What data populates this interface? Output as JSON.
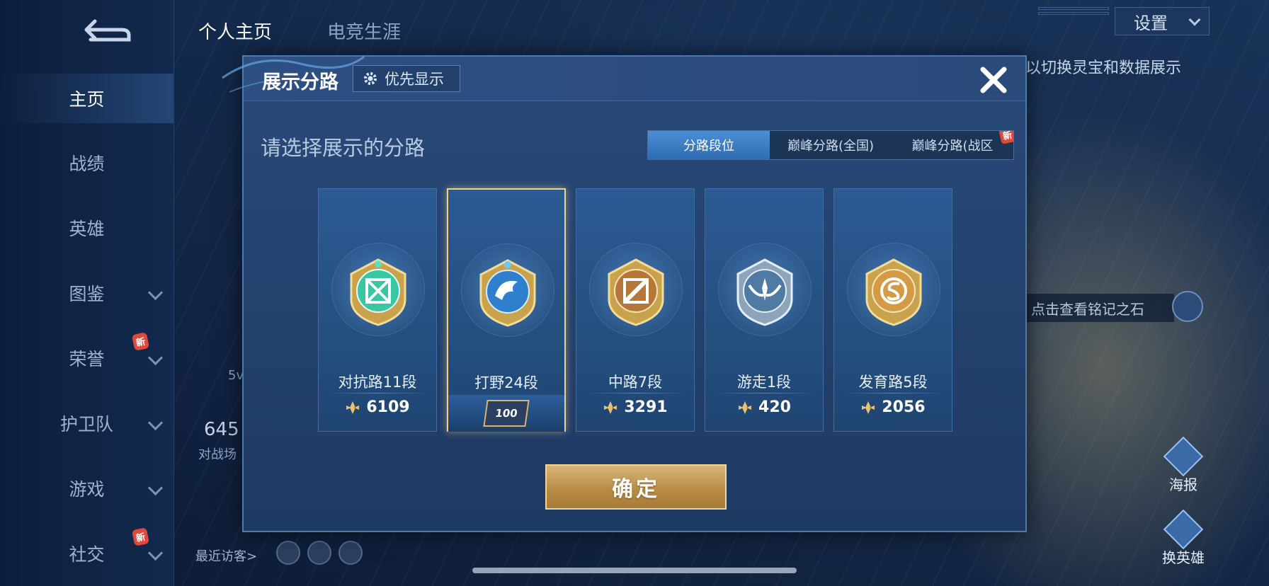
{
  "nav": {
    "items": [
      {
        "label": "主页"
      },
      {
        "label": "战绩"
      },
      {
        "label": "英雄"
      },
      {
        "label": "图鉴"
      },
      {
        "label": "荣誉",
        "badge": "新"
      },
      {
        "label": "护卫队"
      },
      {
        "label": "游戏"
      },
      {
        "label": "社交",
        "badge": "新"
      }
    ]
  },
  "top_tabs": [
    "个人主页",
    "电竞生涯"
  ],
  "settings": {
    "label": "设置"
  },
  "right_hint": "以切换灵宝和数据展示",
  "inscription_hint": "点击查看铭记之石",
  "side_buttons": [
    "海报",
    "换英雄"
  ],
  "visitors_label": "最近访客>",
  "left_obscured": {
    "num": "645",
    "sub": "对战场",
    "small": "5v"
  },
  "dialog": {
    "title": "展示分路",
    "priority_label": "优先显示",
    "subtitle": "请选择展示的分路",
    "segments": [
      {
        "label": "分路段位",
        "active": true
      },
      {
        "label": "巅峰分路(全国)",
        "active": false
      },
      {
        "label": "巅峰分路(战区",
        "active": false,
        "badge": "新"
      }
    ],
    "cards": [
      {
        "name": "对抗路11段",
        "score": "6109",
        "selected": false,
        "emblem": "topline-emblem",
        "color": "#37c7a1"
      },
      {
        "name": "打野24段",
        "score": "",
        "stars": "100",
        "selected": true,
        "emblem": "jungle-dragon-emblem",
        "color": "#4aa7e6"
      },
      {
        "name": "中路7段",
        "score": "3291",
        "selected": false,
        "emblem": "midlane-emblem",
        "color": "#e0a35a"
      },
      {
        "name": "游走1段",
        "score": "420",
        "selected": false,
        "emblem": "roam-emblem",
        "color": "#a9c0d8"
      },
      {
        "name": "发育路5段",
        "score": "2056",
        "selected": false,
        "emblem": "adc-emblem",
        "color": "#e8b65e"
      }
    ],
    "confirm_label": "确定"
  }
}
